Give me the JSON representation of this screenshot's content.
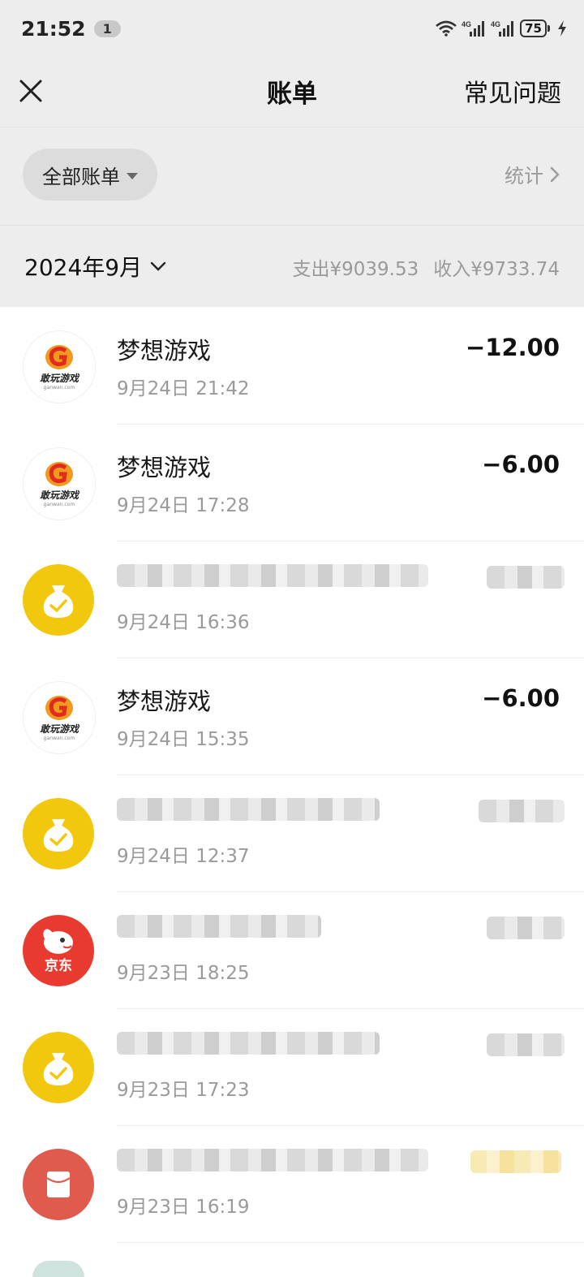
{
  "status_bar": {
    "time": "21:52",
    "notification_count": "1",
    "network_1": "4G",
    "network_2": "4G",
    "battery": "75"
  },
  "nav": {
    "title": "账单",
    "faq_label": "常见问题"
  },
  "filter": {
    "label": "全部账单",
    "stats_label": "统计"
  },
  "month": {
    "label": "2024年9月",
    "expense": "支出¥9039.53",
    "income": "收入¥9733.74"
  },
  "colors": {
    "header_bg": "#ededed",
    "bag_yellow": "#f2c80f",
    "jd_red": "#e83a2e",
    "redpacket": "#e05a4e"
  },
  "transactions": [
    {
      "icon": "gaming-logo-icon",
      "merchant": "梦想游戏",
      "time": "9月24日 21:42",
      "amount": "−12.00"
    },
    {
      "icon": "gaming-logo-icon",
      "merchant": "梦想游戏",
      "time": "9月24日 17:28",
      "amount": "−6.00"
    },
    {
      "icon": "money-bag-icon",
      "merchant": "",
      "time": "9月24日 16:36",
      "amount": ""
    },
    {
      "icon": "gaming-logo-icon",
      "merchant": "梦想游戏",
      "time": "9月24日 15:35",
      "amount": "−6.00"
    },
    {
      "icon": "money-bag-icon",
      "merchant": "",
      "time": "9月24日 12:37",
      "amount": ""
    },
    {
      "icon": "jd-logo-icon",
      "merchant": "",
      "time": "9月23日 18:25",
      "amount": ""
    },
    {
      "icon": "money-bag-icon",
      "merchant": "",
      "time": "9月23日 17:23",
      "amount": ""
    },
    {
      "icon": "red-packet-icon",
      "merchant": "",
      "time": "9月23日 16:19",
      "amount": ""
    }
  ],
  "logos": {
    "game_text": "敢玩游戏",
    "game_sub": "ganwan.com",
    "jd_text": "京东"
  }
}
